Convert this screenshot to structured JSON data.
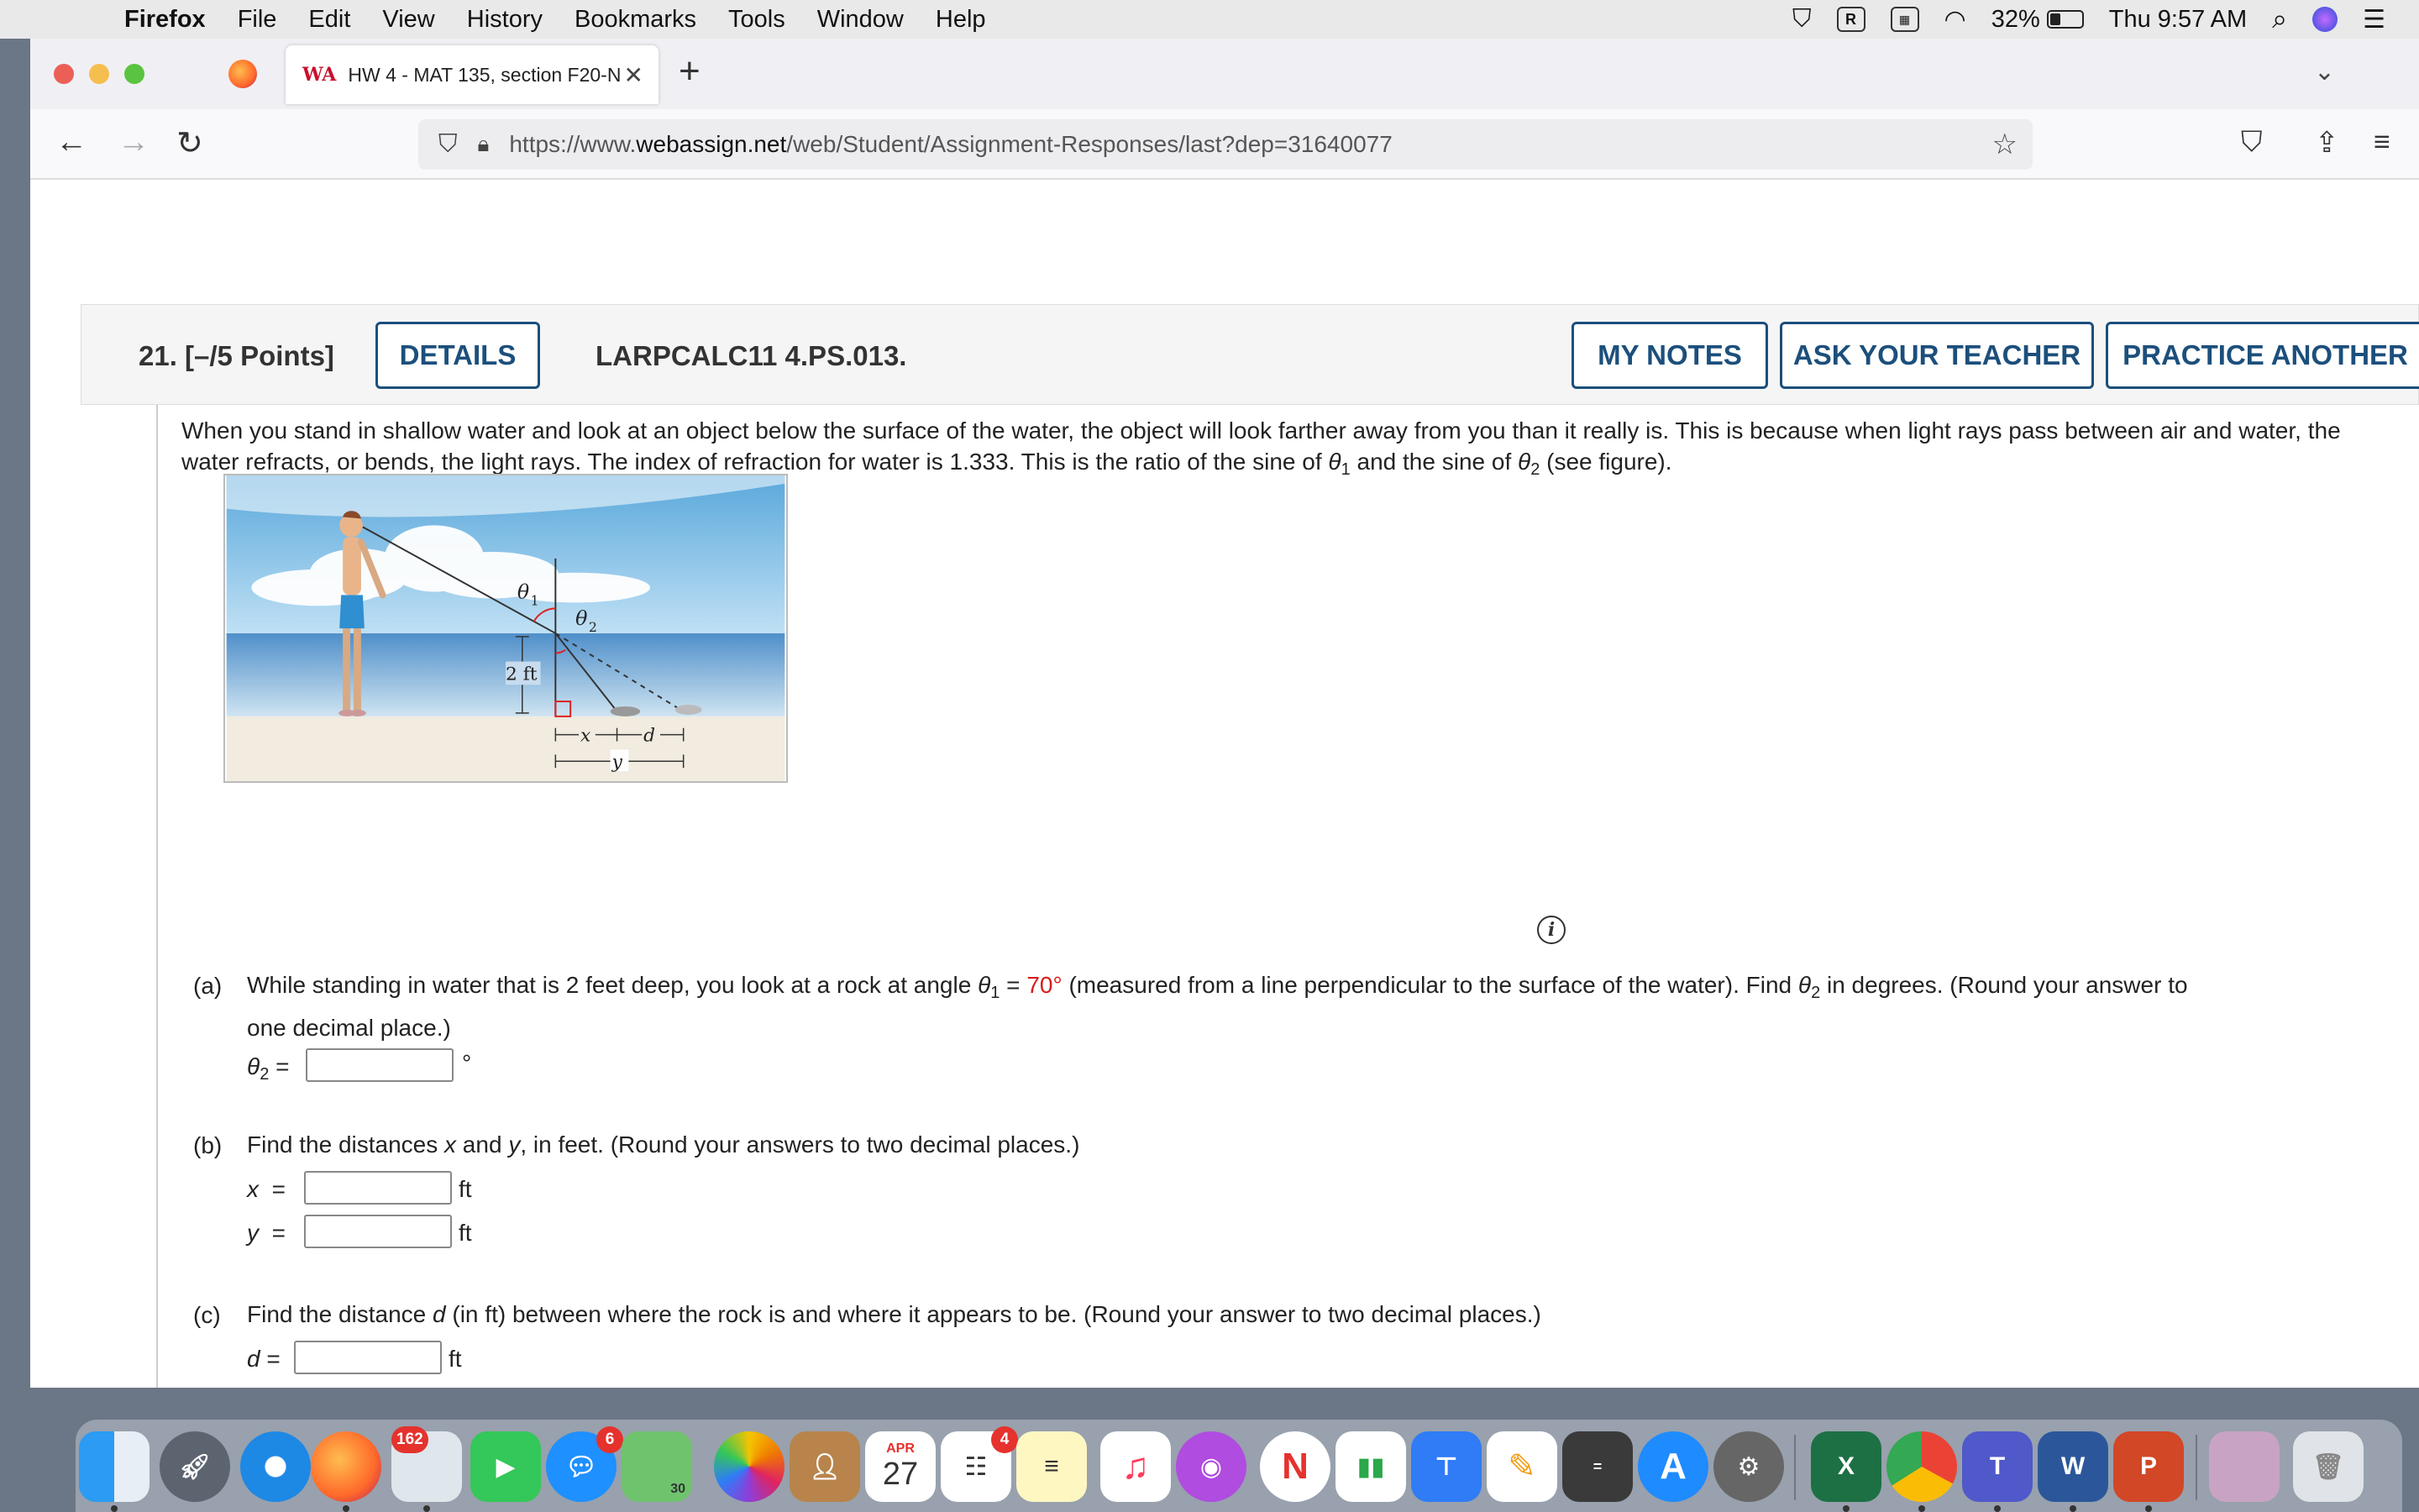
{
  "menubar": {
    "app": "Firefox",
    "items": [
      "File",
      "Edit",
      "View",
      "History",
      "Bookmarks",
      "Tools",
      "Window",
      "Help"
    ],
    "battery_pct": "32%",
    "battery_level": 0.32,
    "clock": "Thu 9:57 AM"
  },
  "browser": {
    "tab_title": "HW 4 - MAT 135, section F20-N",
    "tab_logo": "WA",
    "url_prefix": "https://www.",
    "url_domain": "webassign.net",
    "url_path": "/web/Student/Assignment-Responses/last?dep=31640077"
  },
  "question": {
    "number": "21.",
    "points": "[–/5 Points]",
    "details_btn": "DETAILS",
    "code": "LARPCALC11 4.PS.013.",
    "my_notes_btn": "MY NOTES",
    "ask_teacher_btn": "ASK YOUR TEACHER",
    "practice_btn": "PRACTICE ANOTHER",
    "intro_1": "When you stand in shallow water and look at an object below the surface of the water, the object will look farther away from you than it really is. This is because when light rays pass between air and water, the water refracts, or bends, the light rays. The index of refraction for water is 1.333. This is the ratio of the sine of ",
    "intro_2": " and the sine of ",
    "intro_3": " (see figure).",
    "theta": "θ",
    "sub1": "1",
    "sub2": "2"
  },
  "figure": {
    "theta1_label": "θ",
    "theta1_sub": "1",
    "theta2_label": "θ",
    "theta2_sub": "2",
    "depth_label": "2 ft",
    "x_label": "x",
    "d_label": "d",
    "y_label": "y"
  },
  "part_a": {
    "label": "(a)",
    "text_1": "While standing in water that is 2 feet deep, you look at a rock at angle ",
    "eq": " = ",
    "angle": "70°",
    "text_2": " (measured from a line perpendicular to the surface of the water). Find ",
    "text_3": " in degrees. (Round your answer to",
    "text_4": "one decimal place.)",
    "var": "θ",
    "var_sub": "2",
    "eq_sign": "=",
    "unit": "°",
    "value": ""
  },
  "part_b": {
    "label": "(b)",
    "text_1": "Find the distances ",
    "x": "x",
    "and": " and ",
    "y": "y",
    "text_2": ", in feet. (Round your answers to two decimal places.)",
    "eq_sign": "=",
    "unit": "ft",
    "x_value": "",
    "y_value": ""
  },
  "part_c": {
    "label": "(c)",
    "text_1": "Find the distance ",
    "d": "d",
    "text_2": " (in ft) between where the rock is and where it appears to be. (Round your answer to two decimal places.)",
    "eq_sign": "=",
    "unit": "ft",
    "value": ""
  },
  "dock": {
    "badge_mail": "162",
    "badge_messages": "6",
    "badge_reminders": "4",
    "calendar_month": "APR",
    "calendar_day": "27",
    "maps_label": "30"
  }
}
